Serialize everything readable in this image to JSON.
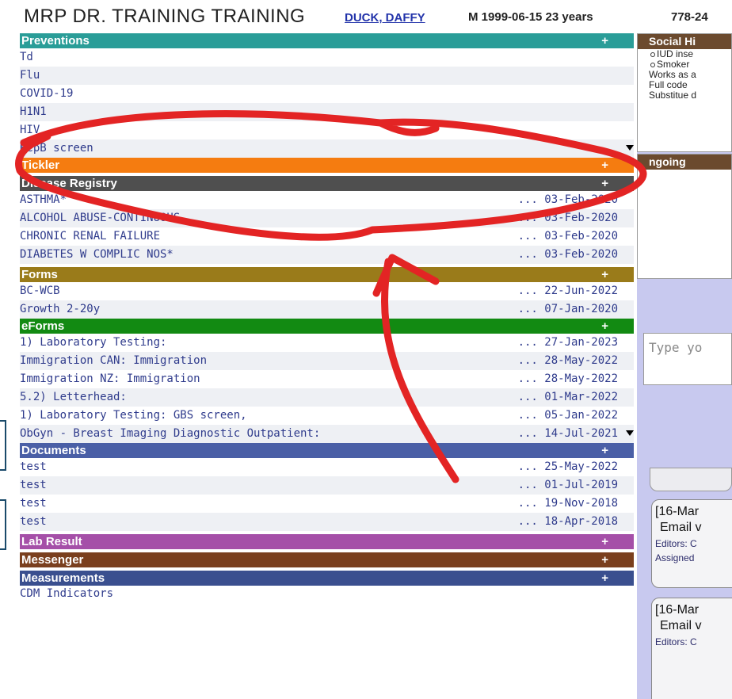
{
  "header": {
    "mrp": "MRP   DR. TRAINING TRAINING",
    "patient_name": "DUCK, DAFFY",
    "patient_info": "M 1999-06-15 23 years",
    "phone": "778-24"
  },
  "colors": {
    "preventions": "#2a9d98",
    "tickler": "#f57c10",
    "disease_registry": "#4f4f4f",
    "forms": "#9a7b1a",
    "eforms": "#128a12",
    "documents": "#4a5fa6",
    "lab_result": "#a54fa8",
    "messenger": "#7a3f1e",
    "measurements": "#3a4f8f",
    "annotation": "#e32424"
  },
  "preventions": {
    "title": "Preventions",
    "plus": "+",
    "items": [
      "Td",
      "Flu",
      "COVID-19",
      "H1N1",
      "HIV",
      "HepB screen"
    ]
  },
  "tickler": {
    "title": "Tickler",
    "plus": "+"
  },
  "disease_registry": {
    "title": "Disease Registry",
    "plus": "+",
    "items": [
      {
        "label": "ASTHMA*",
        "date": "... 03-Feb-2020"
      },
      {
        "label": "ALCOHOL ABUSE-CONTINUOUS",
        "date": "... 03-Feb-2020"
      },
      {
        "label": "CHRONIC RENAL FAILURE",
        "date": "... 03-Feb-2020"
      },
      {
        "label": "DIABETES W COMPLIC NOS*",
        "date": "... 03-Feb-2020"
      }
    ]
  },
  "forms": {
    "title": "Forms",
    "plus": "+",
    "items": [
      {
        "label": "BC-WCB",
        "date": "... 22-Jun-2022"
      },
      {
        "label": "Growth 2-20y",
        "date": "... 07-Jan-2020"
      }
    ]
  },
  "eforms": {
    "title": "eForms",
    "plus": "+",
    "items": [
      {
        "label": "1) Laboratory Testing:",
        "date": "... 27-Jan-2023"
      },
      {
        "label": "Immigration CAN: Immigration",
        "date": "... 28-May-2022"
      },
      {
        "label": "Immigration NZ: Immigration",
        "date": "... 28-May-2022"
      },
      {
        "label": "5.2) Letterhead:",
        "date": "... 01-Mar-2022"
      },
      {
        "label": "1) Laboratory Testing: GBS screen,",
        "date": "... 05-Jan-2022"
      },
      {
        "label": "ObGyn - Breast Imaging Diagnostic Outpatient:",
        "date": "... 14-Jul-2021"
      }
    ]
  },
  "documents": {
    "title": "Documents",
    "plus": "+",
    "items": [
      {
        "label": "test",
        "date": "... 25-May-2022"
      },
      {
        "label": "test",
        "date": "... 01-Jul-2019"
      },
      {
        "label": "test",
        "date": "... 19-Nov-2018"
      },
      {
        "label": "test",
        "date": "... 18-Apr-2018"
      }
    ]
  },
  "lab_result": {
    "title": "Lab Result",
    "plus": "+"
  },
  "messenger": {
    "title": "Messenger",
    "plus": "+"
  },
  "measurements": {
    "title": "Measurements",
    "plus": "+",
    "items": [
      "CDM Indicators"
    ]
  },
  "right": {
    "social_history": {
      "title": "Social Hi",
      "lines": [
        "IUD inse",
        "Smoker"
      ],
      "plain_lines": [
        "Works as a",
        "Full code",
        "Substitue d"
      ]
    },
    "ongoing": {
      "title": "ngoing"
    },
    "type_placeholder": "Type yo",
    "notes": [
      {
        "title": "[16-Mar",
        "subject": "Email v",
        "editors": "Editors: C",
        "assigned": "Assigned"
      },
      {
        "title": "[16-Mar",
        "subject": "Email v",
        "editors": "Editors: C"
      }
    ]
  }
}
